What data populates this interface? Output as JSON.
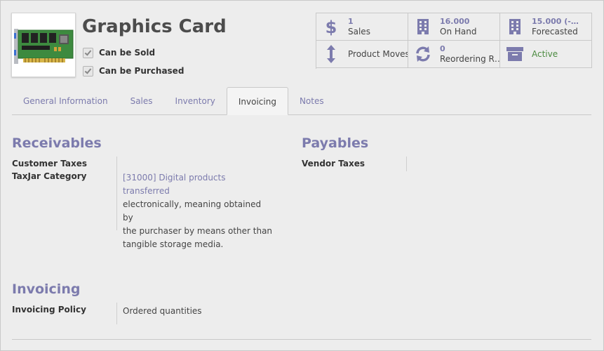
{
  "product": {
    "title": "Graphics Card",
    "can_be_sold": "Can be Sold",
    "can_be_purchased": "Can be Purchased"
  },
  "smart_buttons": [
    {
      "icon": "dollar-icon",
      "number": "1",
      "label": "Sales"
    },
    {
      "icon": "building-icon",
      "number": "16.000",
      "label": "On Hand"
    },
    {
      "icon": "building-icon",
      "number": "15.000 (-…",
      "label": "Forecasted"
    },
    {
      "icon": "arrows-vertical-icon",
      "label": "Product Moves"
    },
    {
      "icon": "refresh-icon",
      "number": "0",
      "label": "Reordering R…"
    },
    {
      "icon": "archive-icon",
      "label": "Active",
      "color": "#4a8a3f"
    }
  ],
  "tabs": [
    {
      "label": "General Information"
    },
    {
      "label": "Sales"
    },
    {
      "label": "Inventory"
    },
    {
      "label": "Invoicing",
      "active": true
    },
    {
      "label": "Notes"
    }
  ],
  "receivables": {
    "title": "Receivables",
    "customer_taxes_label": "Customer Taxes",
    "taxjar_label": "TaxJar Category",
    "taxjar_code": "[31000] Digital products transferred",
    "taxjar_desc_1": "electronically, meaning obtained by",
    "taxjar_desc_2": "the purchaser by means other than",
    "taxjar_desc_3": "tangible storage media."
  },
  "payables": {
    "title": "Payables",
    "vendor_taxes_label": "Vendor Taxes"
  },
  "invoicing": {
    "title": "Invoicing",
    "policy_label": "Invoicing Policy",
    "policy_value": "Ordered quantities"
  },
  "colors": {
    "accent": "#7c7bad",
    "active_green": "#4a8a3f"
  }
}
